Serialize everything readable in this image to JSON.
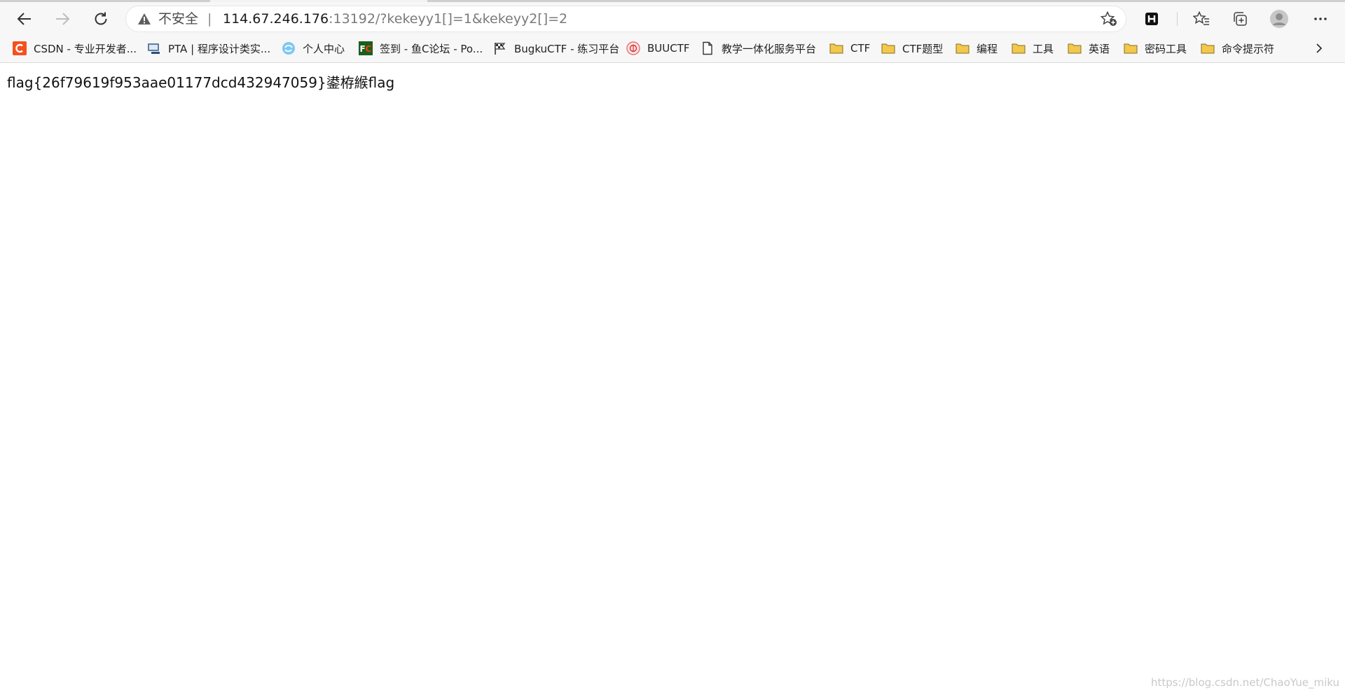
{
  "browser": {
    "address_bar": {
      "security_label": "不安全",
      "separator": "|",
      "url_host": "114.67.246.176",
      "url_rest": ":13192/?kekeyy1[]=1&kekeyy2[]=2"
    },
    "bookmarks": [
      {
        "label": "CSDN - 专业开发者...",
        "icon": "csdn-logo-icon"
      },
      {
        "label": "PTA | 程序设计类实...",
        "icon": "pta-logo-icon"
      },
      {
        "label": "个人中心",
        "icon": "swirl-logo-icon"
      },
      {
        "label": "签到 - 鱼C论坛 - Po...",
        "icon": "fc-logo-icon"
      },
      {
        "label": "BugkuCTF - 练习平台",
        "icon": "flag-logo-icon"
      },
      {
        "label": "BUUCTF",
        "icon": "buuctf-logo-icon"
      },
      {
        "label": "教学一体化服务平台",
        "icon": "page-icon"
      },
      {
        "label": "CTF",
        "icon": "folder-icon"
      },
      {
        "label": "CTF题型",
        "icon": "folder-icon"
      },
      {
        "label": "编程",
        "icon": "folder-icon"
      },
      {
        "label": "工具",
        "icon": "folder-icon"
      },
      {
        "label": "英语",
        "icon": "folder-icon"
      },
      {
        "label": "密码工具",
        "icon": "folder-icon"
      },
      {
        "label": "命令提示符",
        "icon": "folder-icon"
      }
    ],
    "colors": {
      "csdn": "#f4511e",
      "folder": "#f2c94c",
      "fc_bg": "#1b5e20",
      "fc_text": "#ff3d00",
      "warning": "#5f5f5f"
    }
  },
  "page": {
    "body_text": "flag{26f79619f953aae01177dcd432947059}鍙栫緱flag"
  },
  "watermark": "https://blog.csdn.net/ChaoYue_miku"
}
